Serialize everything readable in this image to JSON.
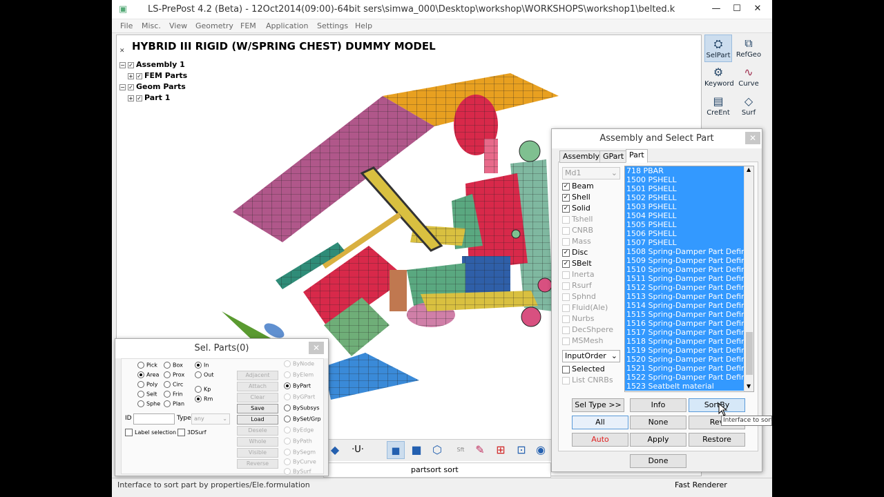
{
  "window": {
    "title": "LS-PrePost 4.2 (Beta) - 12Oct2014(09:00)-64bit sers\\simwa_000\\Desktop\\workshop\\WORKSHOPS\\workshop1\\belted.k",
    "minimize": "—",
    "maximize": "☐",
    "close": "✕"
  },
  "menu": [
    "File",
    "Misc.",
    "View",
    "Geometry",
    "FEM",
    "Application",
    "Settings",
    "Help"
  ],
  "viewport": {
    "model_title": "HYBRID III RIGID (W/SPRING CHEST) DUMMY MODEL",
    "tree": [
      {
        "label": "Assembly 1",
        "level": 0
      },
      {
        "label": "FEM Parts",
        "level": 1
      },
      {
        "label": "Geom Parts",
        "level": 0
      },
      {
        "label": "Part 1",
        "level": 1
      }
    ]
  },
  "right_toolbar": [
    {
      "label": "SelPart",
      "icon": "selpart-icon"
    },
    {
      "label": "RefGeo",
      "icon": "refgeo-icon"
    },
    {
      "label": "Keyword",
      "icon": "keyword-icon"
    },
    {
      "label": "Curve",
      "icon": "curve-icon"
    },
    {
      "label": "CreEnt",
      "icon": "creent-icon"
    },
    {
      "label": "Surf",
      "icon": "surf-icon"
    }
  ],
  "status": {
    "left": "Interface to sort part by properties/Ele.formulation",
    "command": "partsort sort",
    "renderer": "Fast Renderer"
  },
  "bottom_toolbar": {
    "u_label": "U"
  },
  "assembly_dialog": {
    "title": "Assembly and Select Part",
    "close": "✕",
    "tabs": [
      "Assembly",
      "GPart",
      "Part"
    ],
    "active_tab": "Part",
    "model_select": "Md1",
    "types": [
      {
        "label": "Beam",
        "checked": true,
        "enabled": true
      },
      {
        "label": "Shell",
        "checked": true,
        "enabled": true
      },
      {
        "label": "Solid",
        "checked": true,
        "enabled": true
      },
      {
        "label": "Tshell",
        "checked": false,
        "enabled": false
      },
      {
        "label": "CNRB",
        "checked": false,
        "enabled": false
      },
      {
        "label": "Mass",
        "checked": false,
        "enabled": false
      },
      {
        "label": "Disc",
        "checked": true,
        "enabled": true
      },
      {
        "label": "SBelt",
        "checked": true,
        "enabled": true
      },
      {
        "label": "Inerta",
        "checked": false,
        "enabled": false
      },
      {
        "label": "Rsurf",
        "checked": false,
        "enabled": false
      },
      {
        "label": "Sphnd",
        "checked": false,
        "enabled": false
      },
      {
        "label": "Fluid(Ale)",
        "checked": false,
        "enabled": false
      },
      {
        "label": "Nurbs",
        "checked": false,
        "enabled": false
      },
      {
        "label": "DecShpere",
        "checked": false,
        "enabled": false
      },
      {
        "label": "MSMesh",
        "checked": false,
        "enabled": false
      }
    ],
    "order_select": "InputOrder",
    "selected_label": "Selected",
    "list_cnrbs_label": "List CNRBs",
    "parts": [
      "718 PBAR",
      "1500 PSHELL",
      "1501 PSHELL",
      "1502 PSHELL",
      "1503 PSHELL",
      "1504 PSHELL",
      "1505 PSHELL",
      "1506 PSHELL",
      "1507 PSHELL",
      "1508 Spring-Damper Part Definition",
      "1509 Spring-Damper Part Definition",
      "1510 Spring-Damper Part Definition",
      "1511 Spring-Damper Part Definition",
      "1512 Spring-Damper Part Definition",
      "1513 Spring-Damper Part Definition",
      "1514 Spring-Damper Part Definition",
      "1515 Spring-Damper Part Definition",
      "1516 Spring-Damper Part Definition",
      "1517 Spring-Damper Part Definition",
      "1518 Spring-Damper Part Definition",
      "1519 Spring-Damper Part Definition",
      "1520 Spring-Damper Part Definition",
      "1521 Spring-Damper Part Definition",
      "1522 Spring-Damper Part Definition",
      "1523 Seatbelt material"
    ],
    "buttons": {
      "sel_type": "Sel Type >>",
      "info": "Info",
      "sortby": "SortBy",
      "all": "All",
      "none": "None",
      "rev": "Rev",
      "auto": "Auto",
      "apply": "Apply",
      "restore": "Restore",
      "done": "Done"
    },
    "tooltip": "Interface to sort part by properties/Ele.formulation",
    "auto_color": "#e02020",
    "selection_color": "#3399ff"
  },
  "sel_parts_dialog": {
    "title": "Sel. Parts(0)",
    "close": "✕",
    "pick_modes": [
      {
        "label": "Pick",
        "on": false
      },
      {
        "label": "Box",
        "on": false
      },
      {
        "label": "Area",
        "on": true
      },
      {
        "label": "Prox",
        "on": false
      },
      {
        "label": "Poly",
        "on": false
      },
      {
        "label": "Circ",
        "on": false
      },
      {
        "label": "Selt",
        "on": false
      },
      {
        "label": "Frin",
        "on": false
      },
      {
        "label": "Sphe",
        "on": false
      },
      {
        "label": "Plan",
        "on": false
      }
    ],
    "in_out": [
      {
        "label": "In",
        "on": true
      },
      {
        "label": "Out",
        "on": false
      }
    ],
    "kp_rm": [
      {
        "label": "Kp",
        "on": false
      },
      {
        "label": "Rm",
        "on": true
      }
    ],
    "id_label": "ID",
    "type_label": "Type",
    "type_value": "any",
    "label_selection": "Label selection",
    "surf3d": "3DSurf",
    "actions": [
      {
        "label": "Adjacent",
        "on": false
      },
      {
        "label": "Attach",
        "on": false
      },
      {
        "label": "Clear",
        "on": false
      },
      {
        "label": "Save",
        "on": true
      },
      {
        "label": "Load",
        "on": true
      },
      {
        "label": "Desele",
        "on": false
      },
      {
        "label": "Whole",
        "on": false
      },
      {
        "label": "Visible",
        "on": false
      },
      {
        "label": "Reverse",
        "on": false
      }
    ],
    "by_options": [
      {
        "label": "ByNode",
        "on": false,
        "enabled": false
      },
      {
        "label": "ByElem",
        "on": false,
        "enabled": false
      },
      {
        "label": "ByPart",
        "on": true,
        "enabled": true
      },
      {
        "label": "ByGPart",
        "on": false,
        "enabled": false
      },
      {
        "label": "BySubsys",
        "on": false,
        "enabled": true
      },
      {
        "label": "BySet/Grp",
        "on": false,
        "enabled": true
      },
      {
        "label": "ByEdge",
        "on": false,
        "enabled": false
      },
      {
        "label": "ByPath",
        "on": false,
        "enabled": false
      },
      {
        "label": "BySegm",
        "on": false,
        "enabled": false
      },
      {
        "label": "ByCurve",
        "on": false,
        "enabled": false
      },
      {
        "label": "BySurf",
        "on": false,
        "enabled": false
      }
    ]
  }
}
